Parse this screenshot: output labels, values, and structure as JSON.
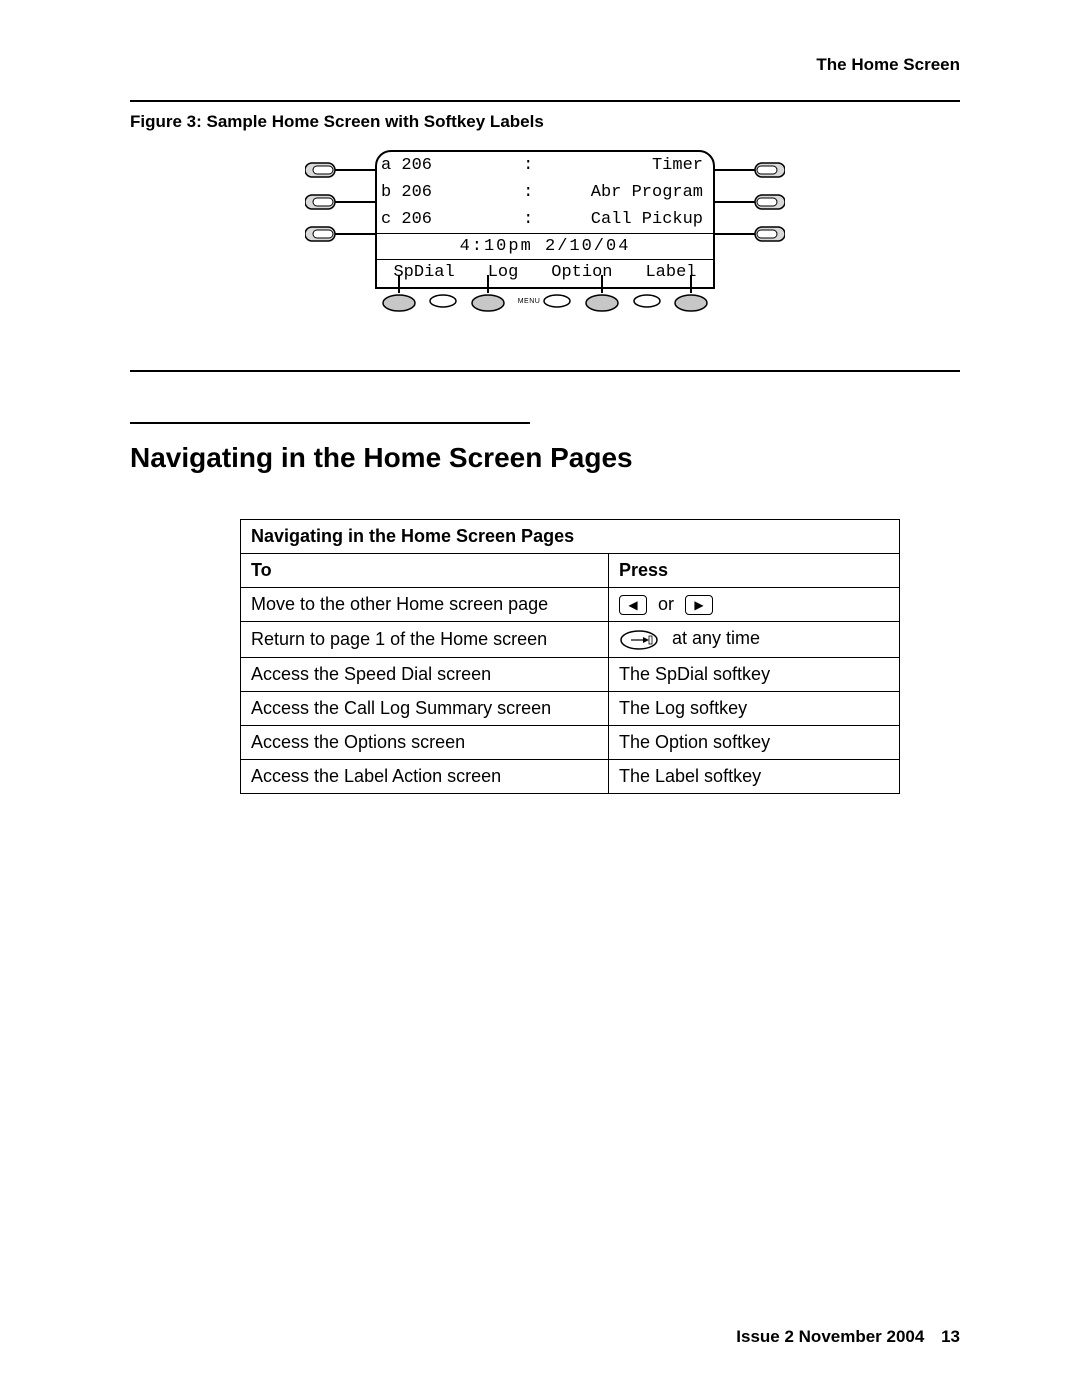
{
  "header": {
    "section_title": "The Home Screen"
  },
  "figure": {
    "caption": "Figure 3: Sample Home Screen with Softkey Labels",
    "lcd": {
      "rows": [
        {
          "left": "a 206",
          "sep": ":",
          "right": "Timer"
        },
        {
          "left": "b 206",
          "sep": ":",
          "right": "Abr Program"
        },
        {
          "left": "c 206",
          "sep": ":",
          "right": "Call Pickup"
        }
      ],
      "datetime": "4:10pm  2/10/04",
      "softkeys": [
        "SpDial",
        "Log",
        "Option",
        "Label"
      ],
      "menu_label": "MENU"
    }
  },
  "section": {
    "heading": "Navigating in the Home Screen Pages"
  },
  "table": {
    "title": "Navigating in the Home Screen Pages",
    "col_to": "To",
    "col_press": "Press",
    "or_word": "or",
    "anytime": "at any time",
    "rows": [
      {
        "to": "Move to the other Home screen page",
        "press_type": "arrows"
      },
      {
        "to": "Return to page 1 of the Home screen",
        "press_type": "phone"
      },
      {
        "to": "Access the Speed Dial screen",
        "press": "The SpDial softkey"
      },
      {
        "to": "Access the Call Log Summary screen",
        "press": "The Log softkey"
      },
      {
        "to": "Access the Options screen",
        "press": "The Option softkey"
      },
      {
        "to": "Access the Label Action screen",
        "press": "The Label softkey"
      }
    ]
  },
  "footer": {
    "issue": "Issue 2   November 2004",
    "page": "13"
  }
}
